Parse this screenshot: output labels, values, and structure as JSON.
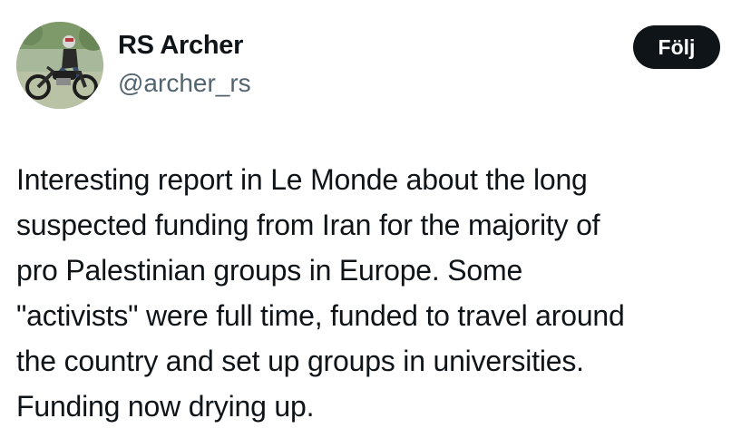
{
  "author": {
    "name": "RS Archer",
    "handle": "@archer_rs",
    "avatar_icon": "motorcycle-rider-photo"
  },
  "follow_button": {
    "label": "Följ"
  },
  "tweet": {
    "text": "Interesting report in Le Monde about the long\nsuspected funding from Iran for the majority of\npro Palestinian groups in Europe.  Some\n\"activists\" were full time, funded to travel around\nthe country and set up groups in universities.\nFunding now drying up."
  },
  "colors": {
    "text_primary": "#0f1419",
    "text_secondary": "#536471",
    "button_bg": "#0f1419",
    "button_text": "#ffffff",
    "background": "#ffffff"
  }
}
